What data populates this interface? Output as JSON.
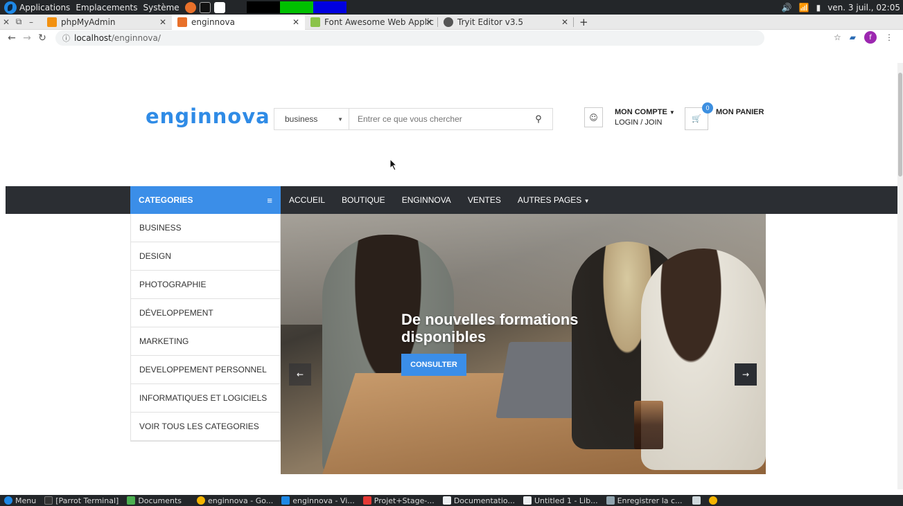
{
  "os_panel": {
    "menus": [
      "Applications",
      "Emplacements",
      "Système"
    ],
    "clock": "ven. 3 juil., 02:05",
    "status_icons": [
      "volume-icon",
      "wifi-icon",
      "battery-icon"
    ]
  },
  "browser": {
    "tabs": [
      {
        "title": "phpMyAdmin",
        "favicon_color": "#f29111"
      },
      {
        "title": "enginnova",
        "favicon_color": "#e8702a"
      },
      {
        "title": "Font Awesome Web Applic",
        "favicon_color": "#8bc34a"
      },
      {
        "title": "Tryit Editor v3.5",
        "favicon_color": "#555555"
      }
    ],
    "new_tab": "+",
    "url_host": "localhost",
    "url_path": "/enginnova/",
    "profile_initial": "f"
  },
  "site": {
    "logo": "enginnova",
    "search": {
      "category": "business",
      "placeholder": "Entrer ce que vous chercher"
    },
    "account": {
      "title": "MON COMPTE",
      "subtitle": "LOGIN / JOIN"
    },
    "cart": {
      "label": "MON PANIER",
      "count": "0"
    },
    "categories_label": "CATEGORIES",
    "menu": [
      "ACCUEIL",
      "BOUTIQUE",
      "ENGINNOVA",
      "VENTES",
      "AUTRES PAGES"
    ],
    "category_list": [
      "BUSINESS",
      "DESIGN",
      "PHOTOGRAPHIE",
      "DÉVELOPPEMENT",
      "MARKETING",
      "DEVELOPPEMENT PERSONNEL",
      "INFORMATIQUES ET LOGICIELS",
      "VOIR TOUS LES CATEGORIES"
    ],
    "hero": {
      "title": "De nouvelles formations disponibles",
      "button": "CONSULTER"
    },
    "colors": {
      "accent": "#3b8ee8",
      "navbar": "#2b2e33"
    }
  },
  "taskbar": {
    "items": [
      "Menu",
      "[Parrot Terminal]",
      "Documents",
      "enginnova - Go...",
      "enginnova - Vi...",
      "Projet+Stage-...",
      "Documentatio...",
      "Untitled 1 - Lib...",
      "Enregistrer la c..."
    ]
  }
}
